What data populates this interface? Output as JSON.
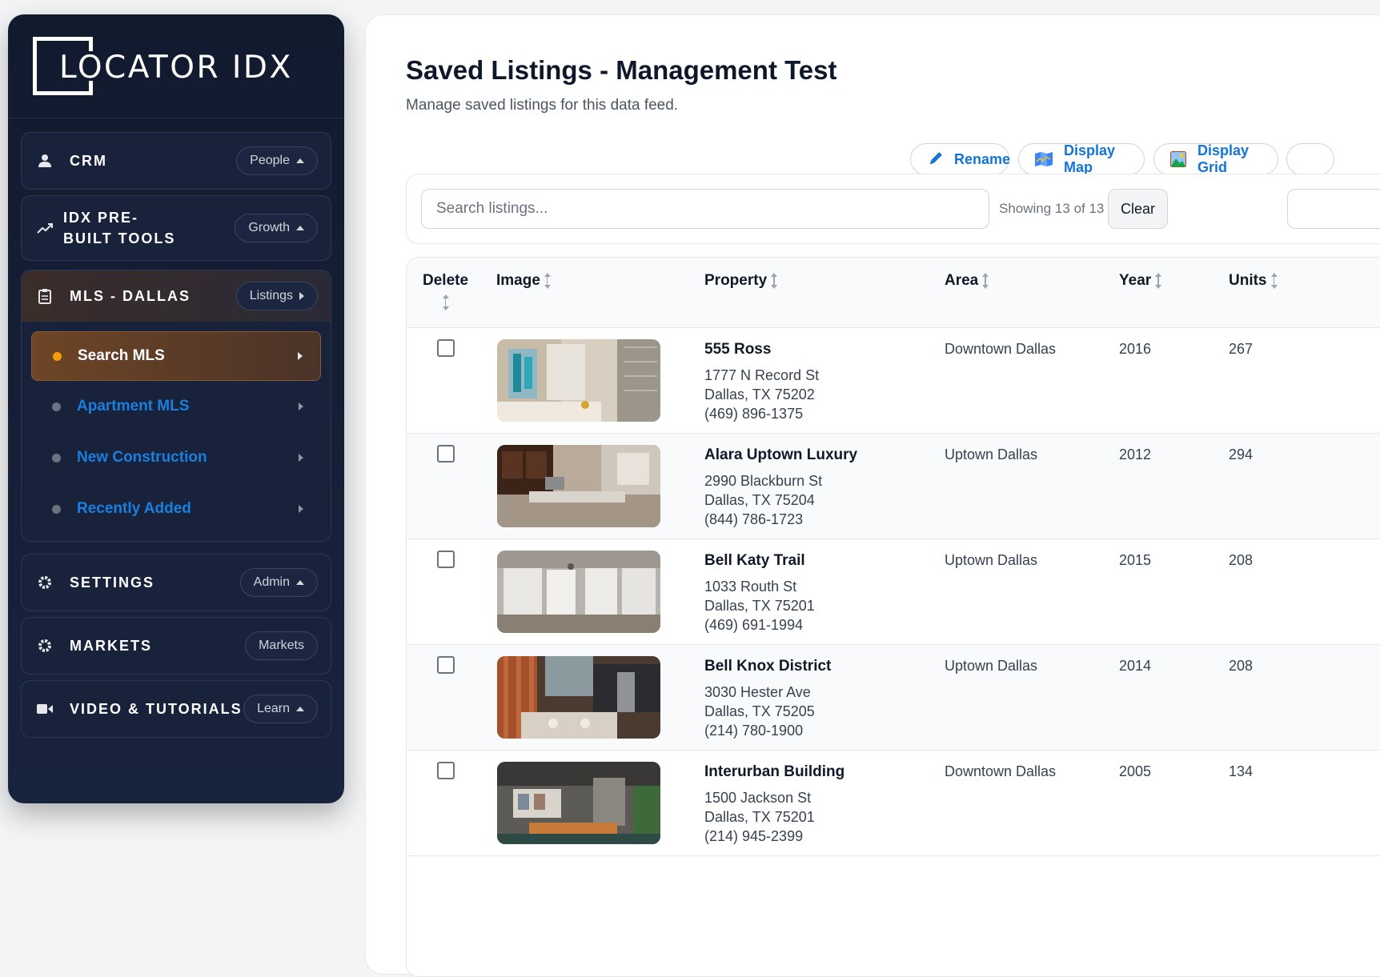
{
  "brand": {
    "logo_text": "LOCATOR IDX"
  },
  "sidebar": {
    "sections": [
      {
        "label": "CRM",
        "pill": "People",
        "icon": "person-icon"
      },
      {
        "label": "IDX PRE-BUILT TOOLS",
        "pill": "Growth",
        "icon": "trend-icon"
      },
      {
        "label": "MLS - DALLAS",
        "pill": "Listings",
        "icon": "clipboard-icon"
      },
      {
        "label": "SETTINGS",
        "pill": "Admin",
        "icon": "gear-icon"
      },
      {
        "label": "MARKETS",
        "pill": "Markets",
        "icon": "gear-icon"
      },
      {
        "label": "VIDEO & TUTORIALS",
        "pill": "Learn",
        "icon": "video-icon"
      }
    ],
    "mls_items": [
      {
        "label": "Search MLS",
        "active": true
      },
      {
        "label": "Apartment MLS",
        "active": false
      },
      {
        "label": "New Construction",
        "active": false
      },
      {
        "label": "Recently Added",
        "active": false
      }
    ]
  },
  "page": {
    "title": "Saved Listings - Management Test",
    "subtitle": "Manage saved listings for this data feed."
  },
  "toolbar": {
    "rename": "Rename",
    "display_map": "Display Map",
    "display_grid": "Display Grid"
  },
  "search": {
    "placeholder": "Search listings...",
    "showing": "Showing 13 of 13",
    "clear": "Clear"
  },
  "table": {
    "columns": [
      "Delete",
      "Image",
      "Property",
      "Area",
      "Year",
      "Units"
    ],
    "rows": [
      {
        "name": "555 Ross",
        "street": "1777 N Record St",
        "city": "Dallas, TX 75202",
        "phone": "(469) 896-1375",
        "area": "Downtown Dallas",
        "year": "2016",
        "units": "267"
      },
      {
        "name": "Alara Uptown Luxury",
        "street": "2990 Blackburn St",
        "city": "Dallas, TX 75204",
        "phone": "(844) 786-1723",
        "area": "Uptown Dallas",
        "year": "2012",
        "units": "294"
      },
      {
        "name": "Bell Katy Trail",
        "street": "1033 Routh St",
        "city": "Dallas, TX 75201",
        "phone": "(469) 691-1994",
        "area": "Uptown Dallas",
        "year": "2015",
        "units": "208"
      },
      {
        "name": "Bell Knox District",
        "street": "3030 Hester Ave",
        "city": "Dallas, TX 75205",
        "phone": "(214) 780-1900",
        "area": "Uptown Dallas",
        "year": "2014",
        "units": "208"
      },
      {
        "name": "Interurban Building",
        "street": "1500 Jackson St",
        "city": "Dallas, TX 75201",
        "phone": "(214) 945-2399",
        "area": "Downtown Dallas",
        "year": "2005",
        "units": "134"
      }
    ]
  },
  "colors": {
    "sidebar_bg": "#121a2e",
    "link_blue": "#1a7fe0",
    "active_accent": "#f59e0b",
    "button_text": "#1474d8"
  }
}
